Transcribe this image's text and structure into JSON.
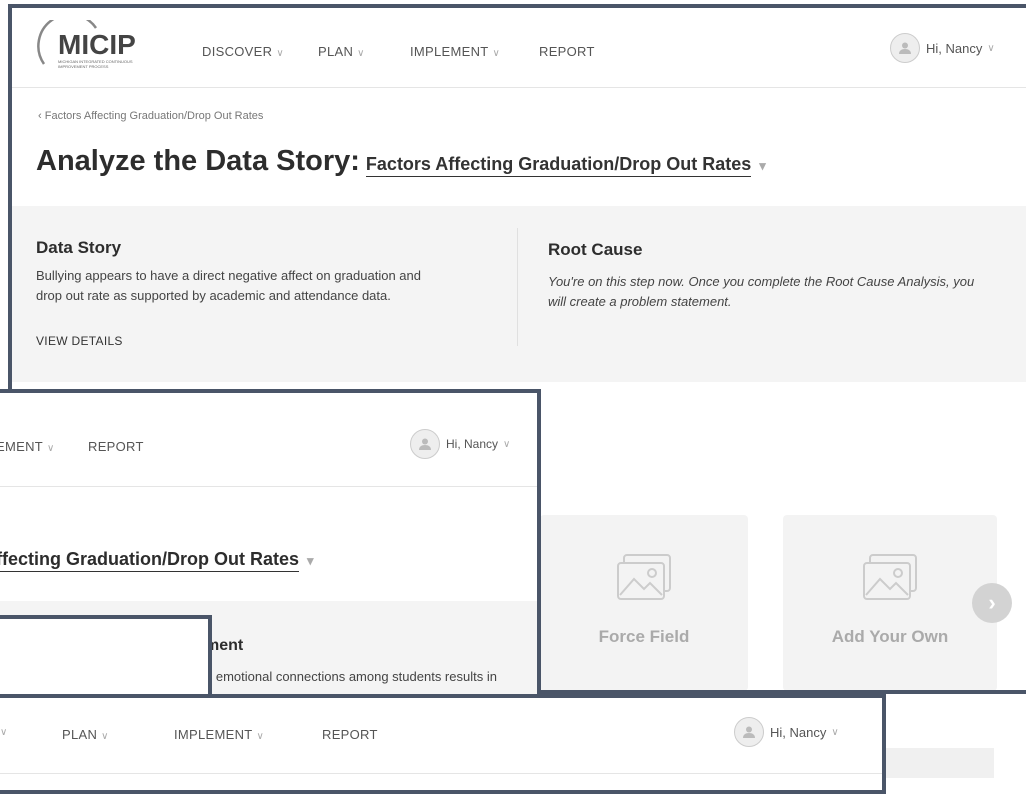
{
  "logo": {
    "text": "MICIP",
    "sub": "MICHIGAN INTEGRATED CONTINUOUS IMPROVEMENT PROCESS"
  },
  "nav": {
    "discover": "DISCOVER",
    "plan": "PLAN",
    "implement": "IMPLEMENT",
    "report": "REPORT",
    "user": "Hi, Nancy"
  },
  "nav2": {
    "implement_partial": "EMENT",
    "report": "REPORT",
    "user": "Hi, Nancy"
  },
  "nav3": {
    "plan": "PLAN",
    "implement": "IMPLEMENT",
    "report": "REPORT",
    "user": "Hi, Nancy"
  },
  "breadcrumb": "Factors Affecting Graduation/Drop Out Rates",
  "heading": {
    "prefix": "Analyze the Data Story:",
    "topic": "Factors Affecting Graduation/Drop Out Rates",
    "topic_partial": "ffecting Graduation/Drop Out Rates"
  },
  "data_story": {
    "title": "Data Story",
    "line1": "Bullying appears to have a direct negative affect on graduation and",
    "line2": "drop out rate as supported by academic and attendance data.",
    "link": "VIEW DETAILS"
  },
  "root_cause": {
    "title": "Root Cause",
    "line1": "You're on this step now. Once you complete the Root Cause Analysis, you",
    "line2": "will create a problem statement."
  },
  "statement": {
    "title_partial": "ment",
    "text_partial": "d emotional connections among students results in"
  },
  "cards": [
    {
      "label": "Force Field"
    },
    {
      "label": "Add Your Own"
    }
  ],
  "colors": {
    "frame": "#4a5568",
    "panel": "#f4f4f4",
    "card": "#f3f3f3"
  }
}
